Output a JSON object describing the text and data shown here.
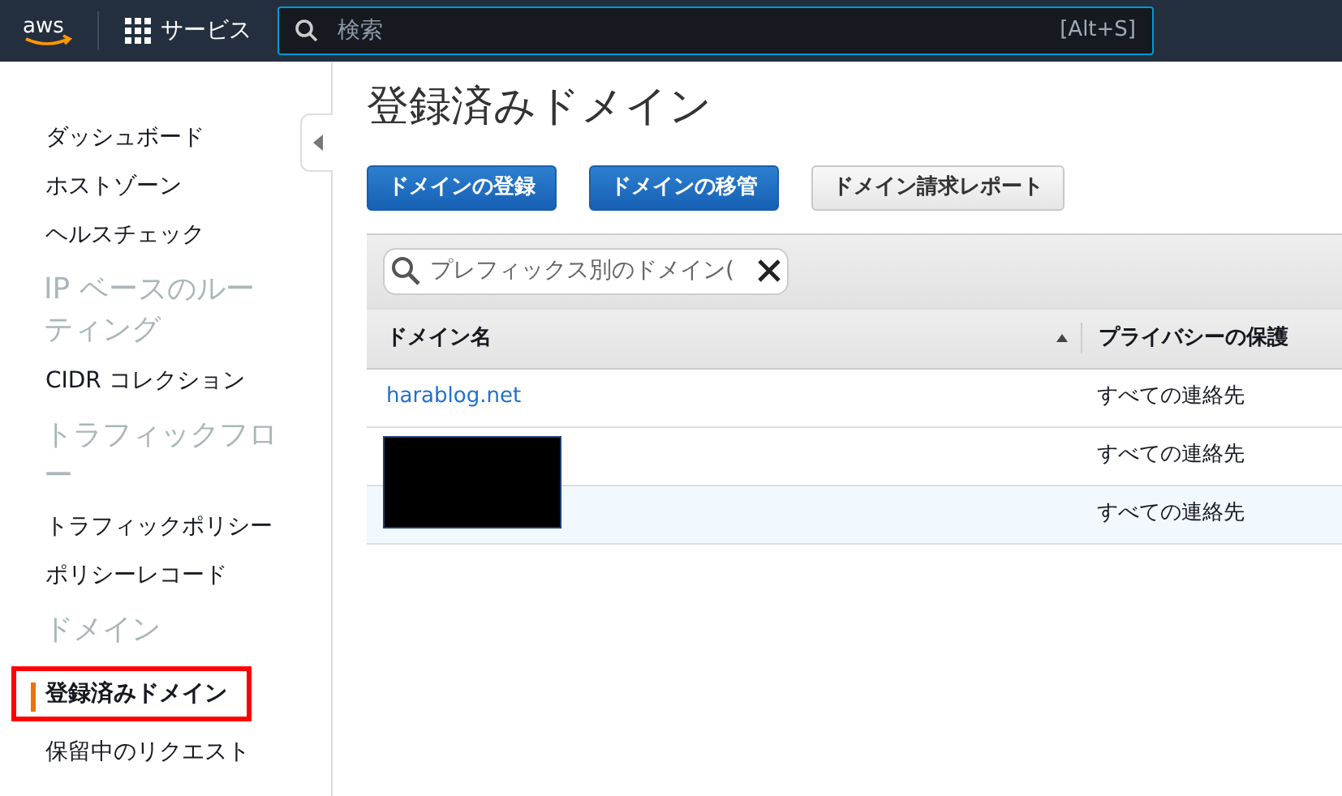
{
  "topbar": {
    "logo": "aws",
    "services_label": "サービス",
    "search": {
      "placeholder": "検索",
      "shortcut": "[Alt+S]"
    }
  },
  "sidebar": {
    "items": [
      {
        "kind": "link",
        "label": "ダッシュボード",
        "selected": false,
        "highlighted": false
      },
      {
        "kind": "link",
        "label": "ホストゾーン",
        "selected": false,
        "highlighted": false
      },
      {
        "kind": "link",
        "label": "ヘルスチェック",
        "selected": false,
        "highlighted": false
      },
      {
        "kind": "heading",
        "label": "IP ベースのルーティング"
      },
      {
        "kind": "link",
        "label": "CIDR コレクション",
        "selected": false,
        "highlighted": false
      },
      {
        "kind": "heading",
        "label": "トラフィックフロー"
      },
      {
        "kind": "link",
        "label": "トラフィックポリシー",
        "selected": false,
        "highlighted": false
      },
      {
        "kind": "link",
        "label": "ポリシーレコード",
        "selected": false,
        "highlighted": false
      },
      {
        "kind": "heading",
        "label": "ドメイン"
      },
      {
        "kind": "link",
        "label": "登録済みドメイン",
        "selected": true,
        "highlighted": true
      },
      {
        "kind": "link",
        "label": "保留中のリクエスト",
        "selected": false,
        "highlighted": false
      }
    ]
  },
  "page": {
    "title": "登録済みドメイン",
    "buttons": [
      {
        "label": "ドメインの登録",
        "kind": "primary"
      },
      {
        "label": "ドメインの移管",
        "kind": "primary"
      },
      {
        "label": "ドメイン請求レポート",
        "kind": "secondary"
      }
    ],
    "filter": {
      "placeholder": "プレフィックス別のドメイン("
    },
    "table": {
      "columns": [
        {
          "label": "ドメイン名",
          "sorted": true
        },
        {
          "label": "プライバシーの保護"
        }
      ],
      "rows": [
        {
          "domain": "harablog.net",
          "privacy": "すべての連絡先",
          "redacted": false,
          "selected": false
        },
        {
          "privacy": "すべての連絡先",
          "redacted": true,
          "selected": false
        },
        {
          "privacy": "すべての連絡先",
          "redacted": true,
          "selected": true
        }
      ]
    }
  }
}
